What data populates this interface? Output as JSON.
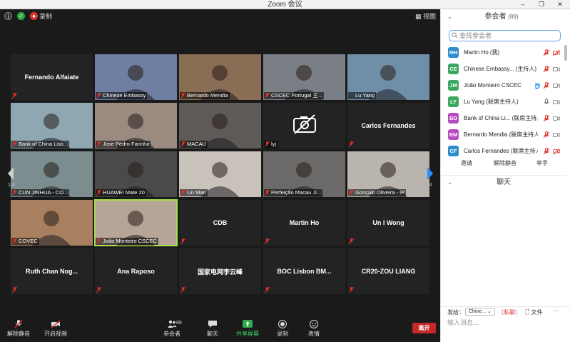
{
  "window": {
    "title": "Zoom 会议",
    "minimize": "–",
    "restore": "❐",
    "close": "✕"
  },
  "meeting_bar": {
    "record_label": "录制",
    "view_label": "视图"
  },
  "tiles": [
    {
      "name": "Fernando Alfaiate",
      "video": false,
      "muted": true
    },
    {
      "name": "Chinese Embassy",
      "video": true,
      "muted": true,
      "bg": "#6f7ea3"
    },
    {
      "name": "Bernardo Mendia",
      "video": true,
      "muted": true,
      "bg": "#8a6d55"
    },
    {
      "name": "CSCEC Portugal 王...",
      "video": true,
      "muted": true,
      "bg": "#7a7f86"
    },
    {
      "name": "Lu Yang",
      "video": true,
      "muted": false,
      "bg": "#6f8ea8"
    },
    {
      "name": "Bank of China Lisb...",
      "video": true,
      "muted": true,
      "bg": "#8fa7b3"
    },
    {
      "name": "Jose Pedro Farinha",
      "video": true,
      "muted": true,
      "bg": "#9a8a80"
    },
    {
      "name": "MACAU",
      "video": true,
      "muted": true,
      "bg": "#5e5a58"
    },
    {
      "name": "lyj",
      "video": false,
      "muted": true,
      "camoff": true
    },
    {
      "name": "Carlos Fernandes",
      "video": false,
      "muted": true
    },
    {
      "name": "CUN JINHUA - CO...",
      "video": true,
      "muted": true,
      "bg": "#7b8d8f"
    },
    {
      "name": "HUAWEI Mate 20",
      "video": true,
      "muted": true,
      "bg": "#4a4a4a"
    },
    {
      "name": "Lin Man",
      "video": true,
      "muted": true,
      "bg": "#c9c2bb"
    },
    {
      "name": "Perfeição Macau Ji...",
      "video": true,
      "muted": true,
      "bg": "#6b6a68"
    },
    {
      "name": "Gonçalo Oliveira - IP",
      "video": true,
      "muted": true,
      "bg": "#b9b4ad"
    },
    {
      "name": "COVEC",
      "video": true,
      "muted": true,
      "bg": "#a88060"
    },
    {
      "name": "João Monteiro CSCEC",
      "video": true,
      "muted": true,
      "bg": "#b6a596",
      "active": true
    },
    {
      "name": "CDB",
      "video": false,
      "muted": true
    },
    {
      "name": "Martin Ho",
      "video": false,
      "muted": true
    },
    {
      "name": "Un I Wong",
      "video": false,
      "muted": true
    },
    {
      "name": "Ruth Chan Nog...",
      "video": false,
      "muted": true
    },
    {
      "name": "Ana Raposo",
      "video": false,
      "muted": true
    },
    {
      "name": "国家电网李云峰",
      "video": false,
      "muted": true
    },
    {
      "name": "BOC Lisbon BM...",
      "video": false,
      "muted": true
    },
    {
      "name": "CR20-ZOU LIANG",
      "video": false,
      "muted": true
    }
  ],
  "pagination": {
    "left": "1/4",
    "right": "1/4"
  },
  "toolbar": {
    "unmute": "解除静音",
    "start_video": "开启视频",
    "participants": "参会者",
    "participants_count": "89",
    "chat": "聊天",
    "share": "共享屏幕",
    "record": "录制",
    "reactions": "表情",
    "leave": "离开"
  },
  "participants_panel": {
    "title": "参会者",
    "count": "(89)",
    "search_placeholder": "查找参会者",
    "list": [
      {
        "initials": "MH",
        "color": "#2d8cc9",
        "name": "Martin Ho (我)",
        "mic": "muted",
        "cam": "off"
      },
      {
        "initials": "CE",
        "color": "#3aa85f",
        "name": "Chinese Embassy... (主持人)",
        "mic": "muted",
        "cam": "on"
      },
      {
        "initials": "JM",
        "color": "#3aa85f",
        "name": "João Monteiro CSCEC",
        "mic": "muted",
        "cam": "on",
        "hand": true
      },
      {
        "initials": "LY",
        "color": "#3aa85f",
        "name": "Lu Yang (联席主持人)",
        "mic": "on",
        "cam": "on"
      },
      {
        "initials": "BO",
        "color": "#b64dbf",
        "name": "Bank of China Li... (联席主持人)",
        "mic": "muted",
        "cam": "on"
      },
      {
        "initials": "BM",
        "color": "#b64dbf",
        "name": "Bernardo Mendia (联席主持人)",
        "mic": "muted",
        "cam": "on"
      },
      {
        "initials": "CF",
        "color": "#2d8cc9",
        "name": "Carlos Fernandes (联席主持人)",
        "mic": "muted",
        "cam": "off"
      }
    ],
    "invite": "邀请",
    "mute_all": "解除静音",
    "raise_hand": "举手"
  },
  "chat_panel": {
    "title": "聊天",
    "send_to_label": "发给：",
    "recipient": "Chine...",
    "private": "（私聊）",
    "file": "文件",
    "more": "···",
    "input_placeholder": "输入消息..."
  },
  "colors": {
    "accent": "#2d8cff",
    "active_speaker": "#a6e04a",
    "leave": "#c62828",
    "muted_red": "#e0302a"
  }
}
